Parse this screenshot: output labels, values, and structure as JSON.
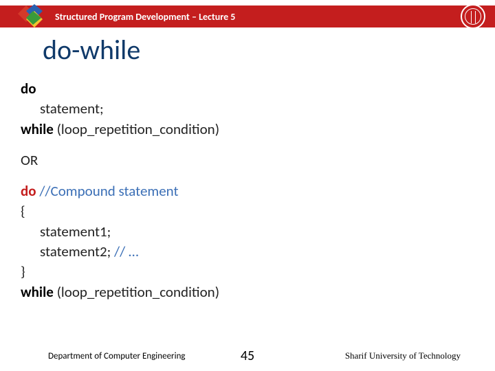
{
  "header": {
    "title": "Structured Program Development – Lecture 5"
  },
  "title": "do-while",
  "body": {
    "l1_do": "do",
    "l1_stmt": "statement;",
    "l1_while": "while ",
    "l1_cond": "(loop_repetition_condition)",
    "or": "OR",
    "l2_do": "do ",
    "l2_comment": "//Compound statement",
    "l2_open": "{",
    "l2_s1": "statement1;",
    "l2_s2": "statement2; ",
    "l2_s2_comment": "// …",
    "l2_close": "}",
    "l2_while": "while ",
    "l2_cond": "(loop_repetition_condition)"
  },
  "footer": {
    "left": "Department of Computer Engineering",
    "page": "45",
    "right": "Sharif University of Technology"
  }
}
